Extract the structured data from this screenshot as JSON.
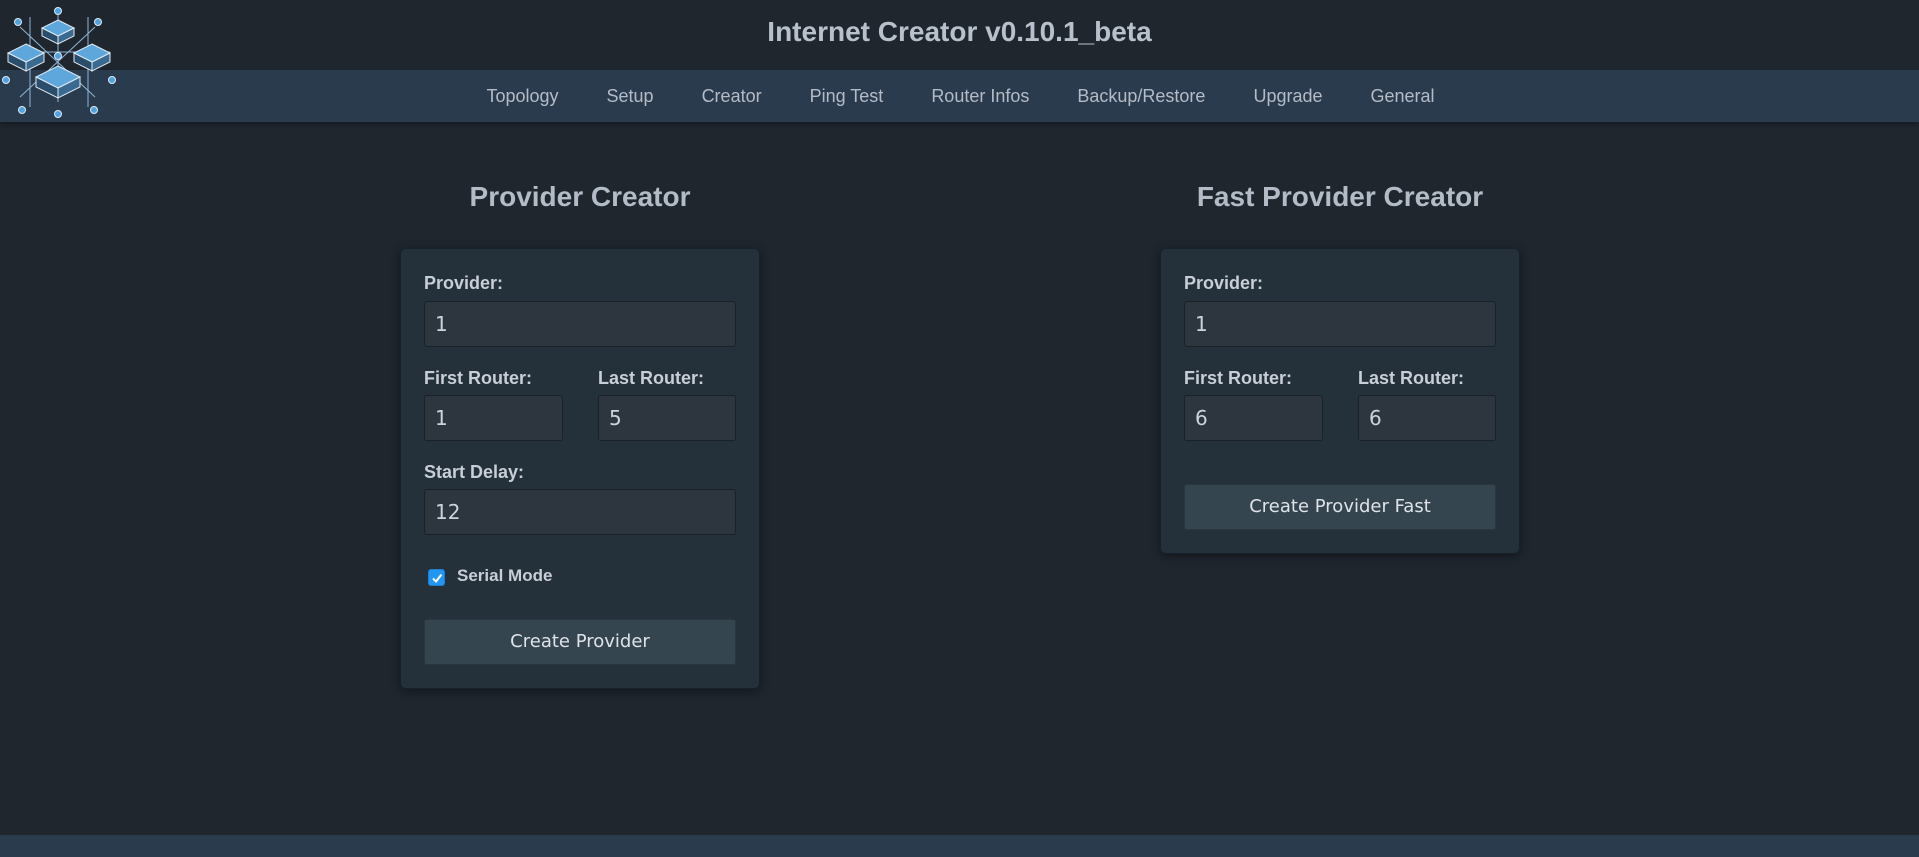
{
  "app": {
    "title": "Internet Creator v0.10.1_beta"
  },
  "nav": {
    "items": [
      {
        "label": "Topology"
      },
      {
        "label": "Setup"
      },
      {
        "label": "Creator"
      },
      {
        "label": "Ping Test"
      },
      {
        "label": "Router Infos"
      },
      {
        "label": "Backup/Restore"
      },
      {
        "label": "Upgrade"
      },
      {
        "label": "General"
      }
    ]
  },
  "provider_creator": {
    "title": "Provider Creator",
    "provider_label": "Provider:",
    "provider_value": "1",
    "first_router_label": "First Router:",
    "first_router_value": "1",
    "last_router_label": "Last Router:",
    "last_router_value": "5",
    "start_delay_label": "Start Delay:",
    "start_delay_value": "12",
    "serial_mode_label": "Serial Mode",
    "serial_mode_checked": true,
    "button_label": "Create Provider"
  },
  "fast_provider_creator": {
    "title": "Fast Provider Creator",
    "provider_label": "Provider:",
    "provider_value": "1",
    "first_router_label": "First Router:",
    "first_router_value": "6",
    "last_router_label": "Last Router:",
    "last_router_value": "6",
    "button_label": "Create Provider Fast"
  },
  "colors": {
    "background": "#1f262e",
    "navbar": "#2b3b4e",
    "card": "#24303a",
    "accent_checkbox": "#2196f3"
  },
  "icons": {
    "logo": "network-servers-logo",
    "checkbox": "checkmark-icon"
  }
}
